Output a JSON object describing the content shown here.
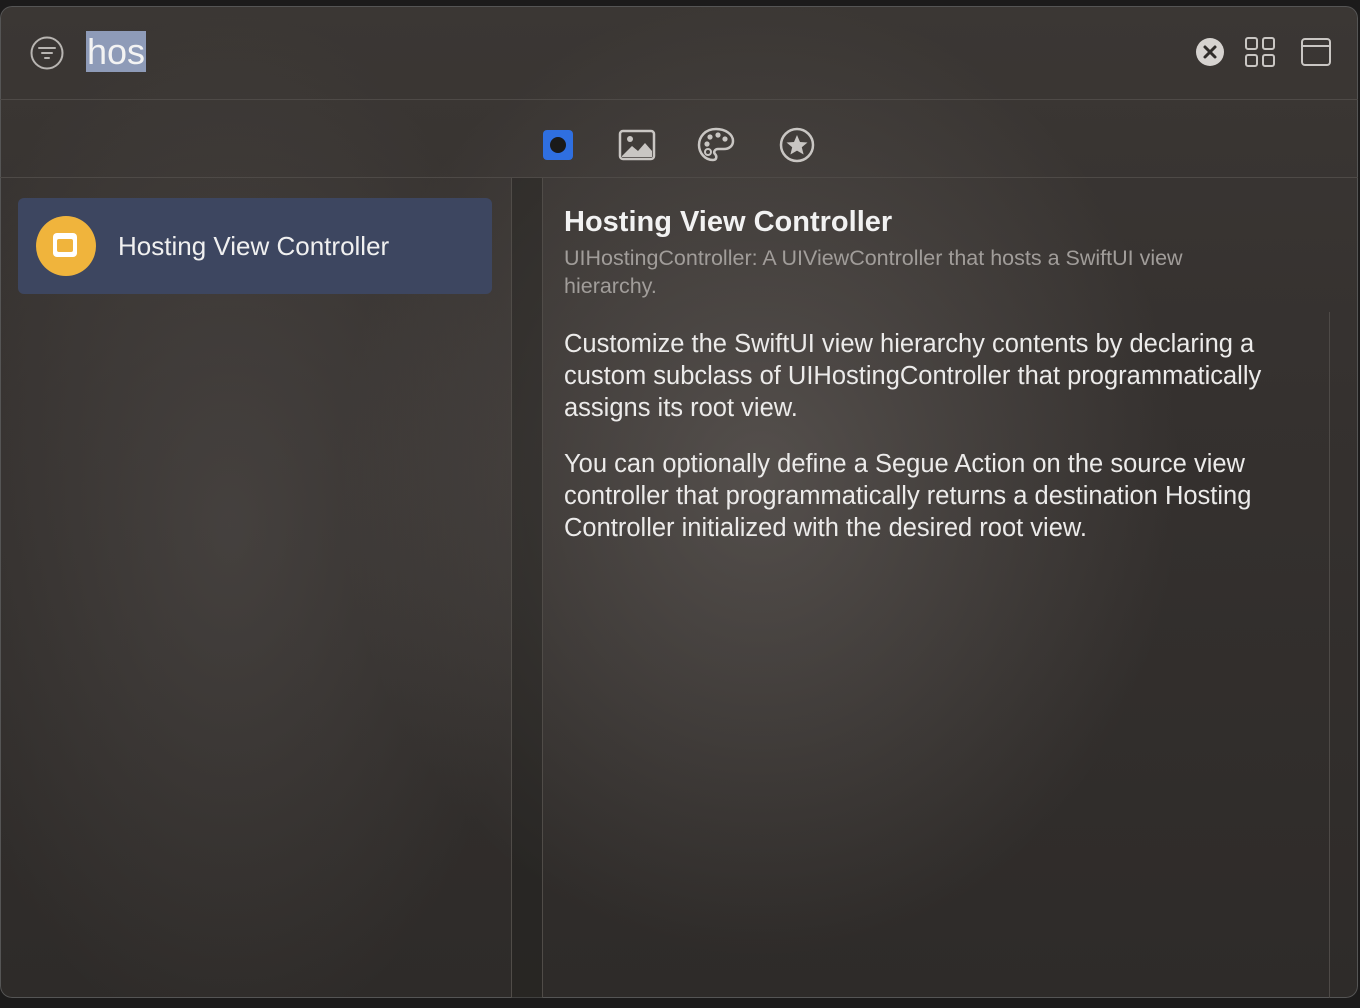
{
  "search": {
    "query": "hos",
    "placeholder": ""
  },
  "tabs": [
    {
      "name": "objects",
      "icon": "objects-icon",
      "selected": true
    },
    {
      "name": "media",
      "icon": "image-icon",
      "selected": false
    },
    {
      "name": "colors",
      "icon": "palette-icon",
      "selected": false
    },
    {
      "name": "favorites",
      "icon": "star-icon",
      "selected": false
    }
  ],
  "results": [
    {
      "label": "Hosting View Controller",
      "icon": "hosting-controller-icon",
      "selected": true
    }
  ],
  "detail": {
    "title": "Hosting View Controller",
    "subtitle": "UIHostingController: A UIViewController that hosts a SwiftUI view hierarchy.",
    "paragraphs": [
      "Customize the SwiftUI view hierarchy contents by declaring a custom subclass of UIHostingController that programmatically assigns its root view.",
      "You can optionally define a Segue Action on the source view controller that programmatically returns a destination Hosting Controller initialized with the desired root view."
    ]
  },
  "colors": {
    "accent": "#2f6fe0",
    "selection": "#3d4660",
    "item_icon": "#f0b43c"
  }
}
